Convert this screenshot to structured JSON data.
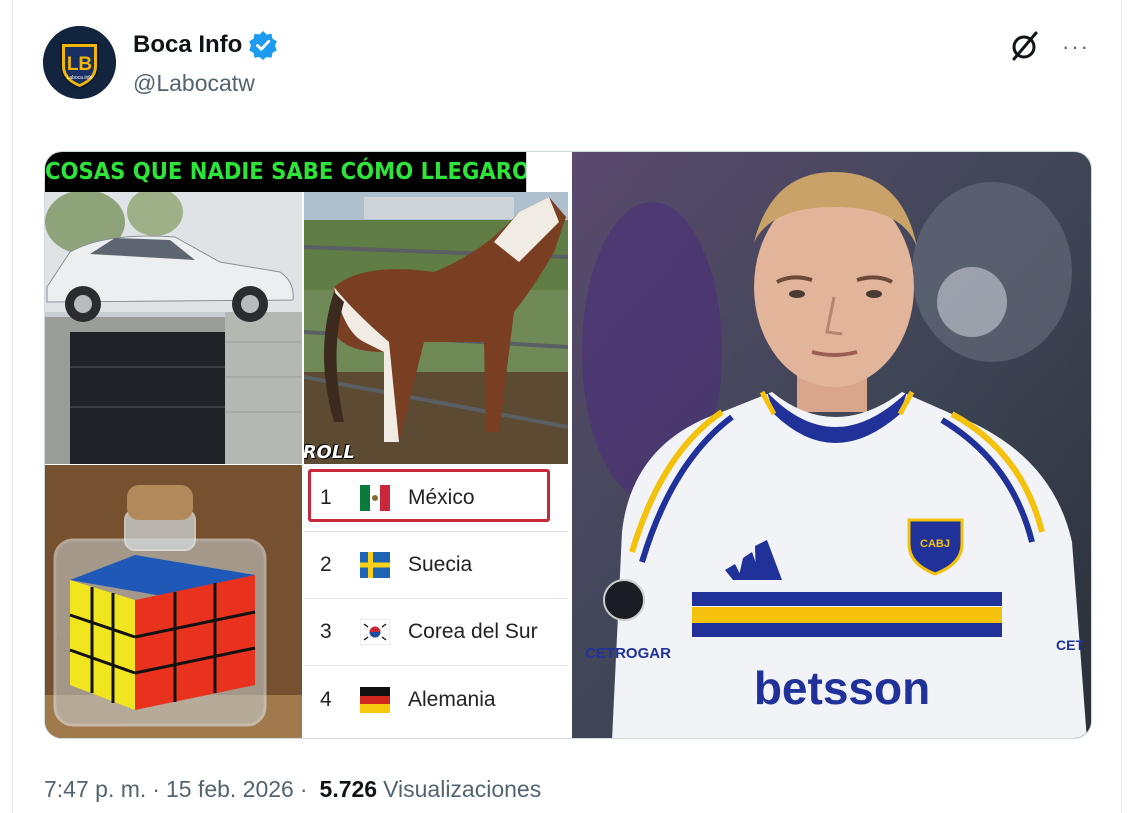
{
  "author": {
    "name": "Boca Info",
    "handle": "@Labocatw",
    "avatar_letters": "LB",
    "avatar_text": "Laboca.info",
    "verified": true
  },
  "meme": {
    "title": "COSAS QUE NADIE SABE CÓMO LLEGARON AHÍ",
    "watermark": "JUANFUTROLL",
    "ranking": [
      {
        "rank": "1",
        "country": "México",
        "flag": "mexico-flag"
      },
      {
        "rank": "2",
        "country": "Suecia",
        "flag": "sweden-flag"
      },
      {
        "rank": "3",
        "country": "Corea del Sur",
        "flag": "south-korea-flag"
      },
      {
        "rank": "4",
        "country": "Alemania",
        "flag": "germany-flag"
      }
    ]
  },
  "photo": {
    "crest": "CABJ",
    "sponsor": "betsson",
    "sleeve_text": "CETROGAR",
    "sleeve_text_right": "CET"
  },
  "footer": {
    "time": "7:47 p. m.",
    "separator1": "·",
    "date": "15 feb. 2026",
    "separator2": "·",
    "views_count": "5.726",
    "views_label": "Visualizaciones"
  },
  "colors": {
    "verified_blue": "#1d9bf0",
    "meme_title_green": "#2ee33a",
    "highlight_red": "#c9283a",
    "jersey_blue": "#20329a",
    "jersey_yellow": "#f4c20d"
  }
}
